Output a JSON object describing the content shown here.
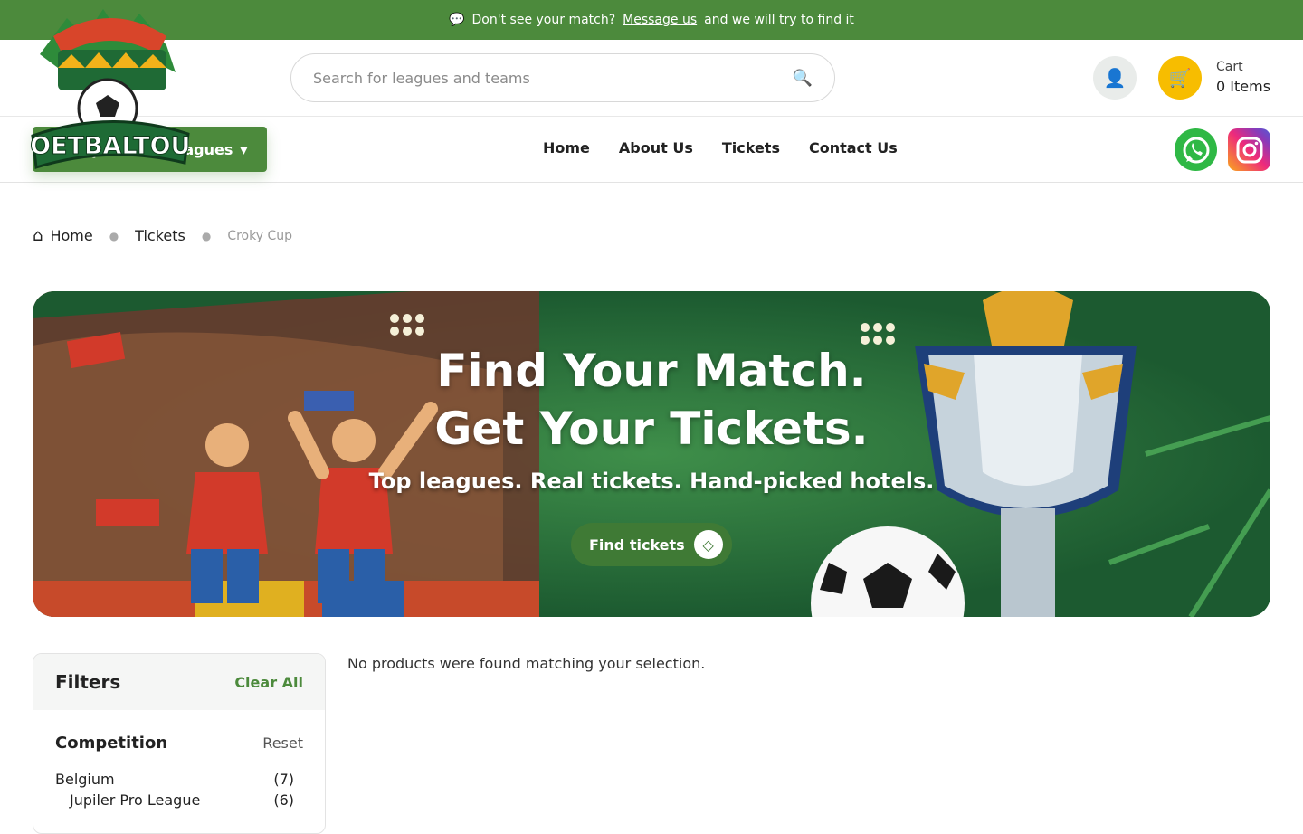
{
  "topbar": {
    "icon": "chat-icon",
    "text": "Don't see your match?",
    "link": "Message us",
    "suffix": "and we will try to find it"
  },
  "header": {
    "logo_text": "VOETBALTOUR",
    "search_placeholder": "Search for leagues and teams",
    "cart_label": "Cart",
    "cart_items": "0 Items"
  },
  "nav": {
    "explore_label": "Explore All Leagues",
    "links": [
      "Home",
      "About Us",
      "Tickets",
      "Contact Us"
    ]
  },
  "breadcrumb": {
    "items": [
      "Home",
      "Tickets",
      "Croky Cup"
    ]
  },
  "hero": {
    "title_line1": "Find Your Match.",
    "title_line2": "Get Your Tickets.",
    "subtitle": "Top leagues. Real tickets. Hand-picked hotels.",
    "cta_label": "Find tickets"
  },
  "filters": {
    "title": "Filters",
    "clear_label": "Clear All",
    "section_title": "Competition",
    "reset_label": "Reset",
    "options": [
      {
        "label": "Belgium",
        "count": "(7)"
      },
      {
        "label": "Jupiler Pro League",
        "count": "(6)"
      }
    ]
  },
  "results": {
    "empty_message": "No products were found matching your selection."
  },
  "colors": {
    "brand_green": "#4c8a3c",
    "cart_yellow": "#f7bd00",
    "whatsapp": "#2fb845"
  }
}
